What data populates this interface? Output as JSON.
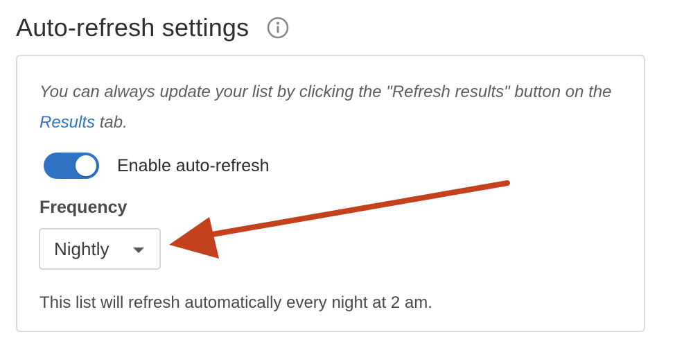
{
  "header": {
    "title": "Auto-refresh settings",
    "info_icon": "info-circle-icon"
  },
  "panel": {
    "hint_prefix": "You can always update your list by clicking the \"Refresh results\" button on the ",
    "hint_link": "Results",
    "hint_suffix": " tab.",
    "toggle": {
      "label": "Enable auto-refresh",
      "enabled": true
    },
    "frequency": {
      "label": "Frequency",
      "selected": "Nightly"
    },
    "footnote": "This list will refresh automatically every night at 2 am."
  },
  "annotation": {
    "icon": "arrow-icon",
    "color": "#c4411e"
  },
  "colors": {
    "accent": "#2f73c4",
    "border": "#dcdcdc",
    "annotation": "#c4411e"
  }
}
